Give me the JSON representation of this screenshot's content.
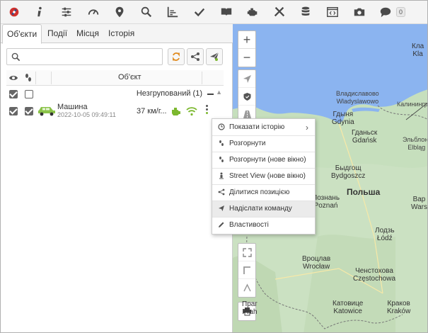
{
  "toolbar": {
    "icons": [
      "logo-icon",
      "info-icon",
      "settings-sliders-icon",
      "gauge-icon",
      "map-pin-icon",
      "search-icon",
      "chart-icon",
      "checkmark-icon",
      "book-icon",
      "engine-icon",
      "tools-icon",
      "database-icon",
      "code-window-icon",
      "camera-icon",
      "chat-icon"
    ],
    "chat_count": "0",
    "icon_color": "#4a4a4a",
    "logo_color": "#d0312d"
  },
  "tabs": [
    {
      "label": "Об'єкти"
    },
    {
      "label": "Події"
    },
    {
      "label": "Місця"
    },
    {
      "label": "Історія"
    }
  ],
  "search": {
    "placeholder": "",
    "value": ""
  },
  "grid": {
    "column_object": "Об'єкт",
    "group_label": "Незгрупований (1)"
  },
  "object": {
    "name": "Машина",
    "timestamp": "2022-10-05 09:49:11",
    "speed": "37 км/г...",
    "car_color": "#8bc34a",
    "status_color": "#7cb82f"
  },
  "context_menu": {
    "items": [
      {
        "label": "Показати історію",
        "icon": "clock-icon",
        "submenu": true
      },
      {
        "label": "Розгорнути",
        "icon": "footprints-icon"
      },
      {
        "label": "Розгорнути (нове вікно)",
        "icon": "footprints-icon"
      },
      {
        "label": "Street View (нове вікно)",
        "icon": "street-person-icon"
      },
      {
        "label": "Ділитися позицією",
        "icon": "share-icon"
      },
      {
        "label": "Надіслати команду",
        "icon": "send-icon",
        "highlighted": true
      },
      {
        "label": "Властивості",
        "icon": "pencil-icon"
      }
    ],
    "submenu_arrow": "›"
  },
  "map": {
    "zoom_in": "+",
    "zoom_out": "−",
    "cities": [
      {
        "name": "Кла\nKla",
        "cls": ""
      },
      {
        "name": "Владиславово\nWladyslawowo",
        "cls": "small"
      },
      {
        "name": "Калининград",
        "cls": "small"
      },
      {
        "name": "Гдыня\nGdynia",
        "cls": ""
      },
      {
        "name": "Гданьск\nGdańsk",
        "cls": ""
      },
      {
        "name": "Эльблонг\nElbląg",
        "cls": "small"
      },
      {
        "name": "Быдгощ\nBydgoszcz",
        "cls": ""
      },
      {
        "name": "Польша",
        "cls": "big"
      },
      {
        "name": "Вар\nWars",
        "cls": ""
      },
      {
        "name": "Познань\nPoznań",
        "cls": ""
      },
      {
        "name": "Лодзь\nŁódź",
        "cls": ""
      },
      {
        "name": "Вроцлав\nWrocław",
        "cls": ""
      },
      {
        "name": "Ченстохова\nCzęstochowa",
        "cls": ""
      },
      {
        "name": "Катовице\nKatowice",
        "cls": ""
      },
      {
        "name": "Краков\nKraków",
        "cls": ""
      },
      {
        "name": "Праг\nPrah",
        "cls": ""
      }
    ],
    "sea_color": "#8bb4f0",
    "land_color": "#c6dfbd"
  }
}
